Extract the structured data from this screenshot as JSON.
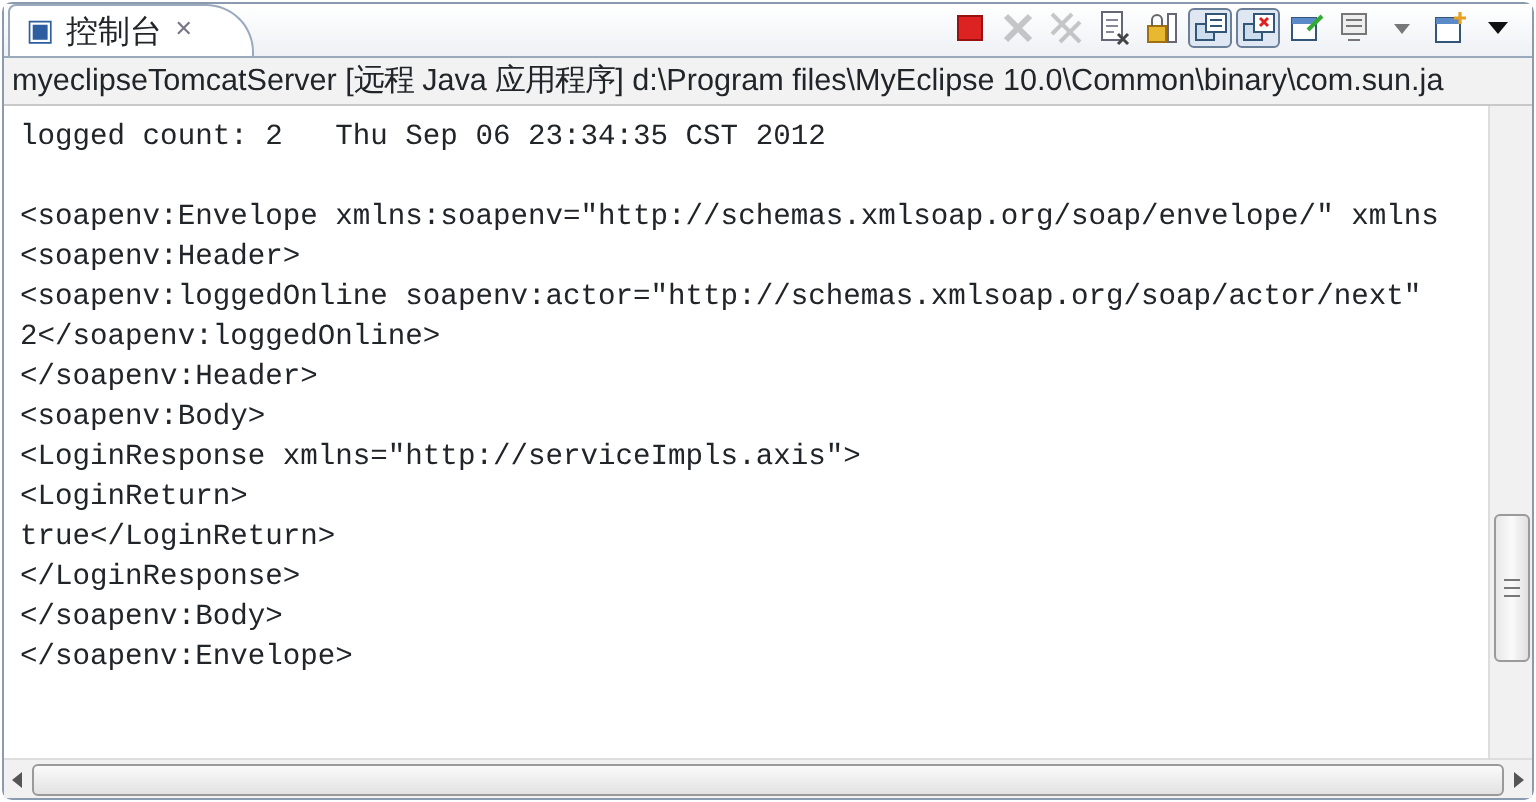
{
  "tab": {
    "icon": "▣",
    "label": "控制台",
    "close": "✕"
  },
  "toolbar": [
    {
      "kind": "terminate",
      "selected": false,
      "disabled": false
    },
    {
      "kind": "remove",
      "selected": false,
      "disabled": true
    },
    {
      "kind": "remove-all",
      "selected": false,
      "disabled": true
    },
    {
      "kind": "clear",
      "selected": false,
      "disabled": false
    },
    {
      "kind": "scroll-lock",
      "selected": false,
      "disabled": false
    },
    {
      "kind": "show-stdout",
      "selected": true,
      "disabled": false
    },
    {
      "kind": "show-stderr",
      "selected": true,
      "disabled": false
    },
    {
      "kind": "pin",
      "selected": false,
      "disabled": false
    },
    {
      "kind": "display",
      "selected": false,
      "disabled": false
    },
    {
      "kind": "dropdown",
      "selected": false,
      "disabled": false
    },
    {
      "kind": "new-console",
      "selected": false,
      "disabled": false
    },
    {
      "kind": "menu",
      "selected": false,
      "disabled": false
    }
  ],
  "process_title": "myeclipseTomcatServer [远程 Java 应用程序] d:\\Program files\\MyEclipse 10.0\\Common\\binary\\com.sun.ja",
  "console_lines": [
    "logged count: 2   Thu Sep 06 23:34:35 CST 2012",
    "<soapenv:Envelope xmlns:soapenv=\"http://schemas.xmlsoap.org/soap/envelope/\" xmlns",
    "<soapenv:Header>",
    "<soapenv:loggedOnline soapenv:actor=\"http://schemas.xmlsoap.org/soap/actor/next\"",
    "2</soapenv:loggedOnline>",
    "</soapenv:Header>",
    "<soapenv:Body>",
    "<LoginResponse xmlns=\"http://serviceImpls.axis\">",
    "<LoginReturn>",
    "true</LoginReturn>",
    "</LoginResponse>",
    "</soapenv:Body>",
    "</soapenv:Envelope>"
  ]
}
